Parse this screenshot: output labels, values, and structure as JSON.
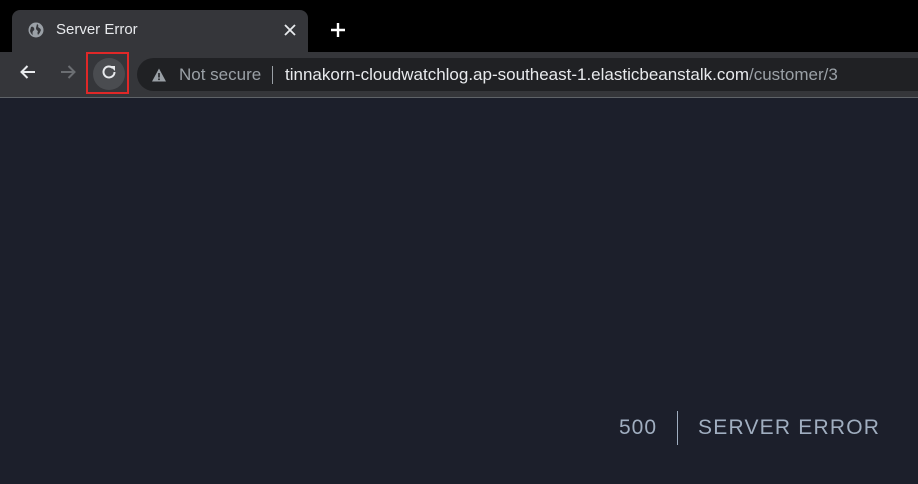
{
  "tab": {
    "title": "Server Error",
    "favicon": "globe-icon",
    "close_icon": "close-icon"
  },
  "toolbar": {
    "back_icon": "back-arrow-icon",
    "forward_icon": "forward-arrow-icon",
    "reload_icon": "reload-icon",
    "new_tab_icon": "plus-icon"
  },
  "omnibox": {
    "security_icon": "warning-icon",
    "security_label": "Not secure",
    "url_host": "tinnakorn-cloudwatchlog.ap-southeast-1.elasticbeanstalk.com",
    "url_path": "/customer/3"
  },
  "page": {
    "error_code": "500",
    "error_message": "SERVER ERROR"
  },
  "colors": {
    "page_background": "#1c1f2b",
    "error_text": "#a0aec0",
    "highlight": "#e02828"
  }
}
